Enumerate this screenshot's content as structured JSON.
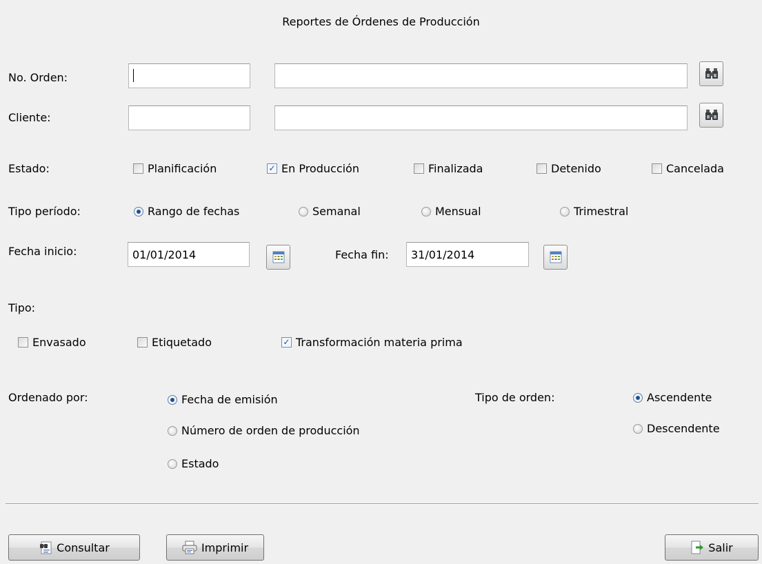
{
  "title": "Reportes de Órdenes de Producción",
  "labels": {
    "orden": "No. Orden:",
    "cliente": "Cliente:",
    "estado": "Estado:",
    "tipo_periodo": "Tipo período:",
    "fecha_inicio": "Fecha inicio:",
    "fecha_fin": "Fecha fin:",
    "tipo": "Tipo:",
    "ordenado_por": "Ordenado por:",
    "tipo_orden": "Tipo de orden:"
  },
  "fields": {
    "orden_code": "",
    "orden_desc": "",
    "cliente_code": "",
    "cliente_desc": "",
    "fecha_inicio": "01/01/2014",
    "fecha_fin": "31/01/2014"
  },
  "estado": [
    {
      "label": "Planificación",
      "checked": false
    },
    {
      "label": "En Producción",
      "checked": true
    },
    {
      "label": "Finalizada",
      "checked": false
    },
    {
      "label": "Detenido",
      "checked": false
    },
    {
      "label": "Cancelada",
      "checked": false
    }
  ],
  "periodo": [
    {
      "label": "Rango de fechas",
      "selected": true
    },
    {
      "label": "Semanal",
      "selected": false
    },
    {
      "label": "Mensual",
      "selected": false
    },
    {
      "label": "Trimestral",
      "selected": false
    }
  ],
  "tipo": [
    {
      "label": "Envasado",
      "checked": false
    },
    {
      "label": "Etiquetado",
      "checked": false
    },
    {
      "label": "Transformación materia prima",
      "checked": true
    }
  ],
  "ordenado": [
    {
      "label": "Fecha de emisión",
      "selected": true
    },
    {
      "label": "Número de orden de producción",
      "selected": false
    },
    {
      "label": "Estado",
      "selected": false
    }
  ],
  "tipo_orden": [
    {
      "label": "Ascendente",
      "selected": true
    },
    {
      "label": "Descendente",
      "selected": false
    }
  ],
  "buttons": {
    "consultar": "Consultar",
    "imprimir": "Imprimir",
    "salir": "Salir"
  },
  "icons": {
    "search": "binoculars-icon",
    "calendar": "calendar-icon",
    "consultar": "binoculars-document-icon",
    "imprimir": "printer-icon",
    "salir": "exit-door-icon"
  }
}
